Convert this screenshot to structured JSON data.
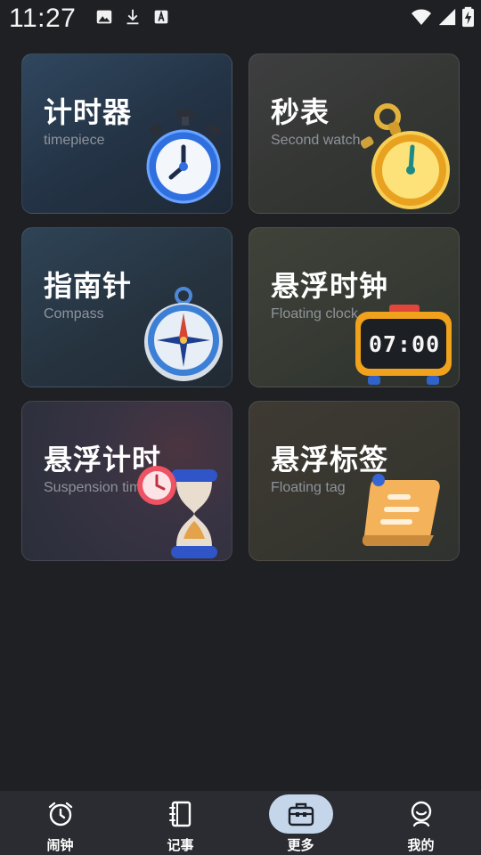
{
  "status_bar": {
    "time": "11:27",
    "left_icons": [
      "image-icon",
      "download-icon",
      "font-icon"
    ],
    "right_icons": [
      "wifi-icon",
      "signal-icon",
      "battery-charging-icon"
    ]
  },
  "cards": [
    {
      "title": "计时器",
      "subtitle": "timepiece",
      "icon": "stopwatch-blue-icon"
    },
    {
      "title": "秒表",
      "subtitle": "Second watch",
      "icon": "pocket-watch-gold-icon"
    },
    {
      "title": "指南针",
      "subtitle": "Compass",
      "icon": "compass-icon"
    },
    {
      "title": "悬浮时钟",
      "subtitle": "Floating clock",
      "icon": "digital-clock-icon",
      "clock_text": "07:00"
    },
    {
      "title": "悬浮计时",
      "subtitle": "Suspension timing",
      "icon": "hourglass-icon"
    },
    {
      "title": "悬浮标签",
      "subtitle": "Floating tag",
      "icon": "note-tag-icon"
    }
  ],
  "bottom_nav": {
    "items": [
      {
        "label": "闹钟",
        "icon": "alarm-clock-icon"
      },
      {
        "label": "记事",
        "icon": "notebook-icon"
      },
      {
        "label": "更多",
        "icon": "toolbox-icon",
        "active": true
      },
      {
        "label": "我的",
        "icon": "profile-icon"
      }
    ]
  },
  "colors": {
    "background": "#1e2024",
    "nav_background": "#2a2c31",
    "active_pill": "#c5d6ea",
    "subtitle": "#8e939b"
  }
}
